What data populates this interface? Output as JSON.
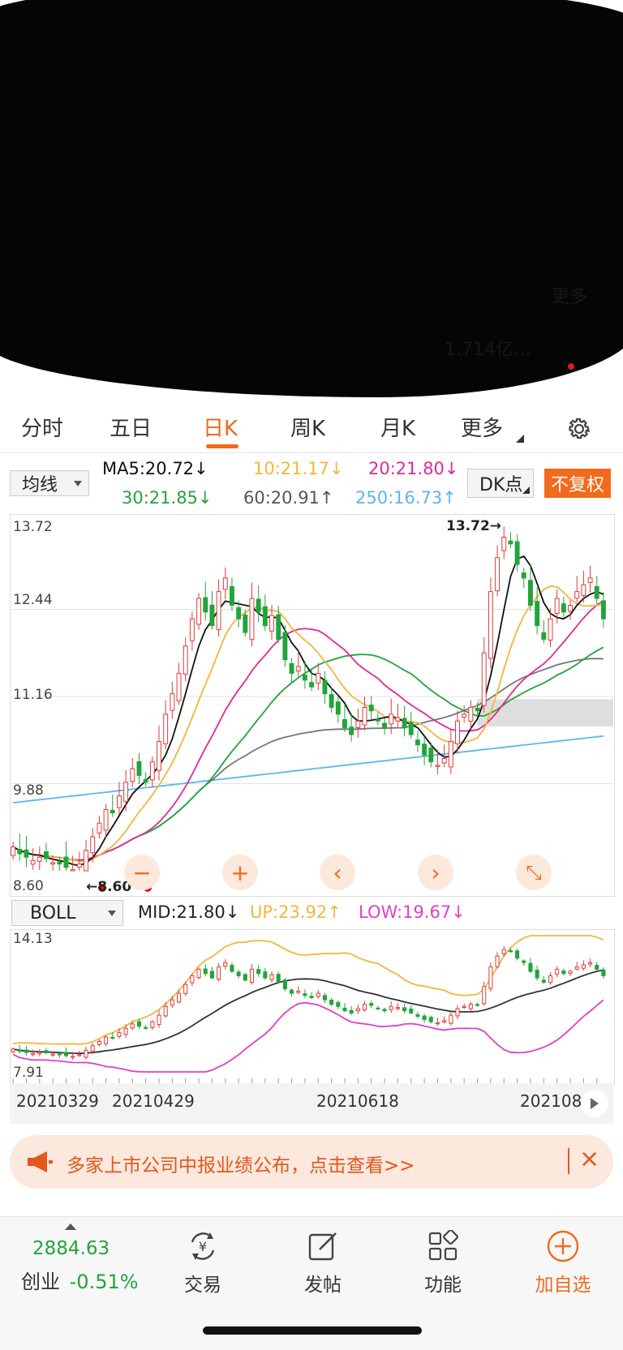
{
  "header": {
    "redacted_fragments": [
      "1.714亿…",
      "更多"
    ]
  },
  "tabs": [
    {
      "label": "分时",
      "active": false
    },
    {
      "label": "五日",
      "active": false
    },
    {
      "label": "日K",
      "active": true
    },
    {
      "label": "周K",
      "active": false
    },
    {
      "label": "月K",
      "active": false
    },
    {
      "label": "更多",
      "active": false
    }
  ],
  "settings_icon": "gear-icon",
  "indicator_bar": {
    "ma_selector": "均线",
    "ma_values": [
      {
        "label": "MA5:20.72",
        "arrow": "↓",
        "color": "#111111"
      },
      {
        "label": "10:21.17",
        "arrow": "↓",
        "color": "#f5b63a"
      },
      {
        "label": "20:21.80",
        "arrow": "↓",
        "color": "#e0299c"
      },
      {
        "label": "30:21.85",
        "arrow": "↓",
        "color": "#21a53a"
      },
      {
        "label": "60:20.91",
        "arrow": "↑",
        "color": "#555555"
      },
      {
        "label": "250:16.73",
        "arrow": "↑",
        "color": "#5bb7ee"
      }
    ],
    "dk_button": "DK点",
    "fuquan_button": "不复权"
  },
  "main_chart": {
    "y_labels": [
      "13.72",
      "12.44",
      "11.16",
      "9.88",
      "8.60"
    ],
    "max_marker": "13.72",
    "min_marker": "8.60"
  },
  "controls": [
    {
      "name": "zoom-out",
      "symbol": "−"
    },
    {
      "name": "zoom-in",
      "symbol": "+"
    },
    {
      "name": "pan-left",
      "symbol": "‹"
    },
    {
      "name": "pan-right",
      "symbol": "›"
    },
    {
      "name": "fullscreen",
      "symbol": "⤡"
    }
  ],
  "boll": {
    "selector": "BOLL",
    "mid": "MID:21.80",
    "mid_arrow": "↓",
    "up": "UP:23.92",
    "up_arrow": "↑",
    "low": "LOW:19.67",
    "low_arrow": "↓",
    "y_top": "14.13",
    "y_bottom": "7.91"
  },
  "dates": [
    "20210329",
    "20210429",
    "20210618",
    "202108"
  ],
  "banner": {
    "text": "多家上市公司中报业绩公布，点击查看>>",
    "close": "×"
  },
  "bottom_nav": {
    "index_value": "2884.63",
    "index_name": "创业",
    "index_change": "-0.51%",
    "items": [
      {
        "label": "交易",
        "icon": "yen-exchange-icon"
      },
      {
        "label": "发帖",
        "icon": "edit-icon"
      },
      {
        "label": "功能",
        "icon": "grid-icon"
      },
      {
        "label": "加自选",
        "icon": "add-circle-icon"
      }
    ]
  },
  "colors": {
    "accent": "#f26a1b",
    "up": "#e33a3a",
    "down": "#21a53a",
    "ma5": "#111111",
    "ma10": "#f5b63a",
    "ma20": "#e0299c",
    "ma30": "#21a53a",
    "ma60": "#777777",
    "ma250": "#5bb7ee"
  },
  "chart_data": {
    "type": "candlestick",
    "ylim": [
      8.6,
      13.72
    ],
    "boll_ylim": [
      7.91,
      14.13
    ],
    "x_ticks": [
      "20210329",
      "20210429",
      "20210618",
      "202108"
    ],
    "series": [
      {
        "name": "MA5",
        "last": 20.72
      },
      {
        "name": "MA10",
        "last": 21.17
      },
      {
        "name": "MA20",
        "last": 21.8
      },
      {
        "name": "MA30",
        "last": 21.85
      },
      {
        "name": "MA60",
        "last": 20.91
      },
      {
        "name": "MA250",
        "last": 16.73
      },
      {
        "name": "MID",
        "last": 21.8
      },
      {
        "name": "UP",
        "last": 23.92
      },
      {
        "name": "LOW",
        "last": 19.67
      }
    ],
    "closes": [
      8.95,
      8.85,
      8.8,
      8.75,
      8.8,
      8.78,
      8.72,
      8.7,
      8.65,
      8.62,
      8.7,
      8.9,
      9.1,
      9.3,
      9.5,
      9.45,
      9.7,
      9.9,
      10.1,
      10.0,
      9.9,
      10.2,
      10.5,
      10.9,
      11.2,
      11.5,
      11.9,
      12.3,
      12.6,
      12.4,
      12.2,
      12.7,
      12.9,
      12.5,
      12.3,
      12.1,
      12.6,
      12.4,
      12.2,
      12.35,
      12.0,
      11.7,
      11.5,
      11.6,
      11.4,
      11.3,
      11.5,
      11.2,
      11.0,
      10.9,
      10.7,
      10.6,
      10.8,
      11.0,
      10.95,
      10.8,
      10.7,
      10.9,
      10.85,
      10.7,
      10.6,
      10.45,
      10.3,
      10.2,
      10.15,
      10.25,
      10.5,
      10.8,
      10.9,
      11.0,
      10.95,
      11.8,
      12.7,
      13.2,
      13.5,
      13.4,
      13.1,
      12.9,
      12.5,
      12.2,
      12.0,
      12.3,
      12.6,
      12.4,
      12.5,
      12.7,
      12.8,
      12.9,
      12.6,
      12.3
    ]
  }
}
